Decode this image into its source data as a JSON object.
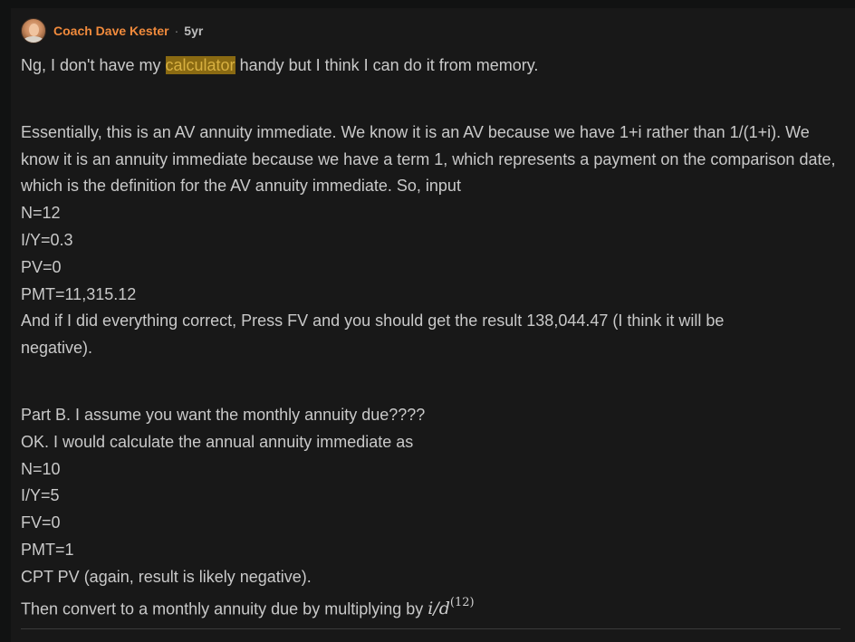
{
  "comment": {
    "author": "Coach Dave Kester",
    "separator": "·",
    "age": "5yr",
    "intro": {
      "before": "Ng, I don't have my ",
      "highlight": "calculator",
      "after": " handy but I think I can do it from memory."
    },
    "part_a": {
      "explanation": "Essentially, this is an AV annuity immediate. We know it is an AV because we have 1+i rather than 1/(1+i). We know it is an annuity immediate because we have a term 1, which represents a payment on the comparison date, which is the definition for the AV annuity immediate. So, input",
      "inputs": [
        "N=12",
        "I/Y=0.3",
        "PV=0",
        "PMT=11,315.12"
      ],
      "conclusion": "And if I did everything correct, Press FV and you should get the result 138,044.47 (I think it will be negative)."
    },
    "part_b": {
      "lines": [
        "Part B. I assume you want the monthly annuity due????",
        "OK. I would calculate the annual annuity immediate as",
        "N=10",
        "I/Y=5",
        "FV=0",
        "PMT=1",
        "CPT PV (again, result is likely negative)."
      ],
      "final_text": "Then convert to a monthly annuity due by multiplying by ",
      "formula_base": "i/d",
      "formula_sup": "(12)"
    }
  }
}
